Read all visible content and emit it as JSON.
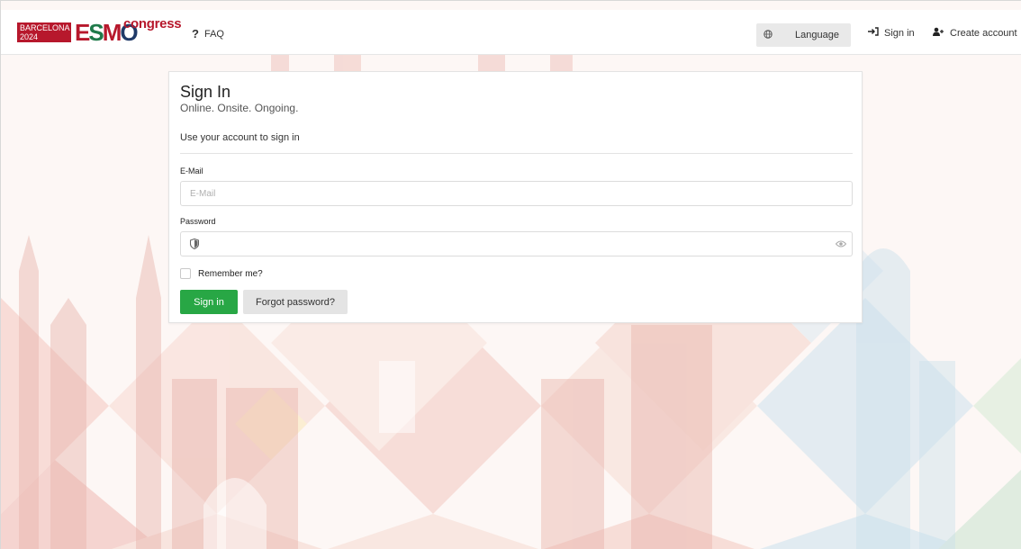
{
  "header": {
    "logo": {
      "city_line1": "BARCELONA",
      "city_line2": "2024",
      "brand_e": "E",
      "brand_s": "S",
      "brand_m": "M",
      "brand_o": "O",
      "brand_suffix": "congress"
    },
    "faq_icon": "?",
    "faq_label": "FAQ",
    "language_label": "Language",
    "language_icon": "globe-icon",
    "signin_label": "Sign in",
    "signin_icon": "sign-in-icon",
    "create_label": "Create account",
    "create_icon": "user-plus-icon"
  },
  "form": {
    "title": "Sign In",
    "subtitle": "Online. Onsite. Ongoing.",
    "instruction": "Use your account to sign in",
    "email_label": "E-Mail",
    "email_placeholder": "E-Mail",
    "email_value": "",
    "password_label": "Password",
    "password_value": "",
    "password_icon": "shield-icon",
    "toggle_icon": "eye-icon",
    "remember_label": "Remember me?",
    "remember_checked": false,
    "signin_button": "Sign in",
    "forgot_button": "Forgot password?"
  },
  "colors": {
    "brand_red": "#b7182c",
    "brand_green": "#1f7a4a",
    "brand_navy": "#1f3a68",
    "primary_button": "#28a745",
    "secondary_button": "#e4e4e4"
  }
}
